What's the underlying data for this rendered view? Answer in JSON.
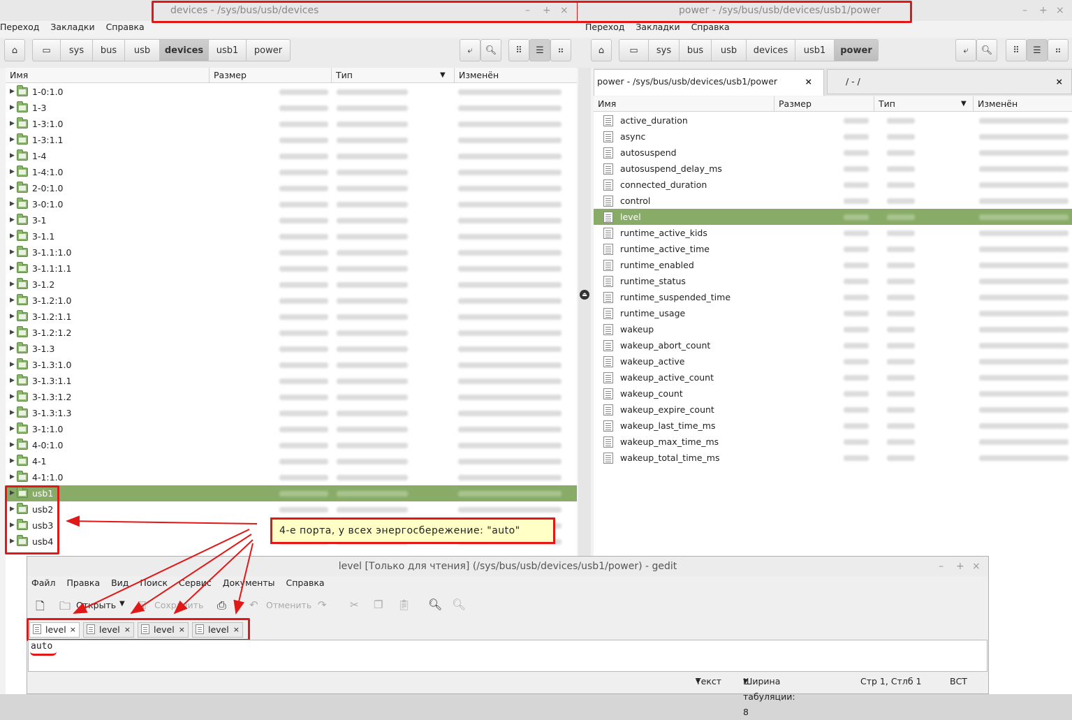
{
  "left_window": {
    "title": "devices - /sys/bus/usb/devices",
    "menu": [
      "Переход",
      "Закладки",
      "Справка"
    ],
    "breadcrumbs": [
      "sys",
      "bus",
      "usb",
      "devices",
      "usb1",
      "power"
    ],
    "active_crumb": "devices",
    "columns": [
      "Имя",
      "Размер",
      "Тип",
      "Изменён"
    ],
    "rows": [
      "1-0:1.0",
      "1-3",
      "1-3:1.0",
      "1-3:1.1",
      "1-4",
      "1-4:1.0",
      "2-0:1.0",
      "3-0:1.0",
      "3-1",
      "3-1.1",
      "3-1.1:1.0",
      "3-1.1:1.1",
      "3-1.2",
      "3-1.2:1.0",
      "3-1.2:1.1",
      "3-1.2:1.2",
      "3-1.3",
      "3-1.3:1.0",
      "3-1.3:1.1",
      "3-1.3:1.2",
      "3-1.3:1.3",
      "3-1:1.0",
      "4-0:1.0",
      "4-1",
      "4-1:1.0",
      "usb1",
      "usb2",
      "usb3",
      "usb4"
    ],
    "selected": "usb1"
  },
  "right_window": {
    "title": "power - /sys/bus/usb/devices/usb1/power",
    "menu": [
      "Переход",
      "Закладки",
      "Справка"
    ],
    "breadcrumbs": [
      "sys",
      "bus",
      "usb",
      "devices",
      "usb1",
      "power"
    ],
    "active_crumb": "power",
    "tabs": [
      "power - /sys/bus/usb/devices/usb1/power",
      "/ - /"
    ],
    "columns": [
      "Имя",
      "Размер",
      "Тип",
      "Изменён"
    ],
    "rows": [
      "active_duration",
      "async",
      "autosuspend",
      "autosuspend_delay_ms",
      "connected_duration",
      "control",
      "level",
      "runtime_active_kids",
      "runtime_active_time",
      "runtime_enabled",
      "runtime_status",
      "runtime_suspended_time",
      "runtime_usage",
      "wakeup",
      "wakeup_abort_count",
      "wakeup_active",
      "wakeup_active_count",
      "wakeup_count",
      "wakeup_expire_count",
      "wakeup_last_time_ms",
      "wakeup_max_time_ms",
      "wakeup_total_time_ms"
    ],
    "selected": "level"
  },
  "annotation": "4-е порта, у всех энергосбережение: \"auto\"",
  "gedit": {
    "title": "level [Только для чтения] (/sys/bus/usb/devices/usb1/power) - gedit",
    "menu": [
      "Файл",
      "Правка",
      "Вид",
      "Поиск",
      "Сервис",
      "Документы",
      "Справка"
    ],
    "open_label": "Открыть",
    "save_label": "Сохранить",
    "undo_label": "Отменить",
    "tabs": [
      "level",
      "level",
      "level",
      "level"
    ],
    "content": "auto",
    "status": {
      "mode": "Текст",
      "tab_width": "Ширина табуляции:  8",
      "position": "Стр 1, Стлб 1",
      "insert": "ВСТ"
    }
  },
  "colors": {
    "selection": "#88ac68",
    "annotation": "#e01818",
    "note_bg": "#ffffc6"
  }
}
